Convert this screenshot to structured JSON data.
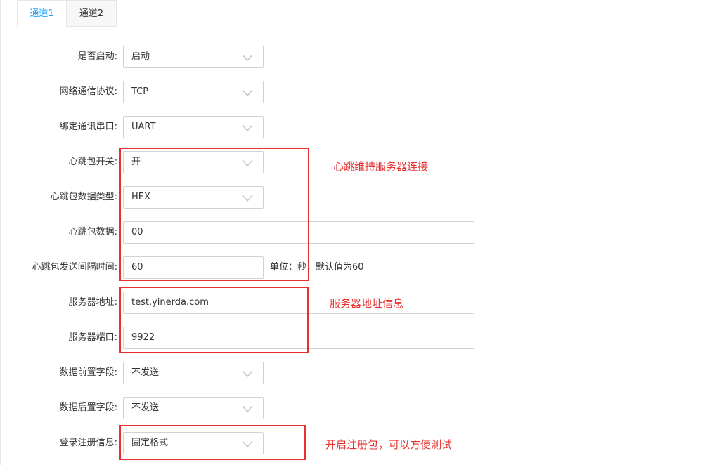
{
  "tabs": [
    {
      "label": "通道1",
      "active": true
    },
    {
      "label": "通道2",
      "active": false
    }
  ],
  "form": {
    "enable": {
      "label": "是否启动:",
      "value": "启动"
    },
    "protocol": {
      "label": "网络通信协议:",
      "value": "TCP"
    },
    "serial": {
      "label": "绑定通讯串口:",
      "value": "UART"
    },
    "heartbeat_switch": {
      "label": "心跳包开关:",
      "value": "开"
    },
    "heartbeat_type": {
      "label": "心跳包数据类型:",
      "value": "HEX"
    },
    "heartbeat_data": {
      "label": "心跳包数据:",
      "value": "00"
    },
    "heartbeat_interval": {
      "label": "心跳包发送间隔时间:",
      "value": "60",
      "hint": "单位：秒，默认值为60"
    },
    "server_address": {
      "label": "服务器地址:",
      "value": "test.yinerda.com"
    },
    "server_port": {
      "label": "服务器端口:",
      "value": "9922"
    },
    "prefix_field": {
      "label": "数据前置字段:",
      "value": "不发送"
    },
    "suffix_field": {
      "label": "数据后置字段:",
      "value": "不发送"
    },
    "login_info": {
      "label": "登录注册信息:",
      "value": "固定格式"
    }
  },
  "annotations": {
    "heartbeat": "心跳维持服务器连接",
    "server": "服务器地址信息",
    "register": "开启注册包，可以方便测试"
  },
  "icons": {
    "select_arrow": "chevron-down-icon"
  },
  "colors": {
    "accent": "#1e9fff",
    "annotation": "#e8312f",
    "border": "#d2d2d2"
  }
}
